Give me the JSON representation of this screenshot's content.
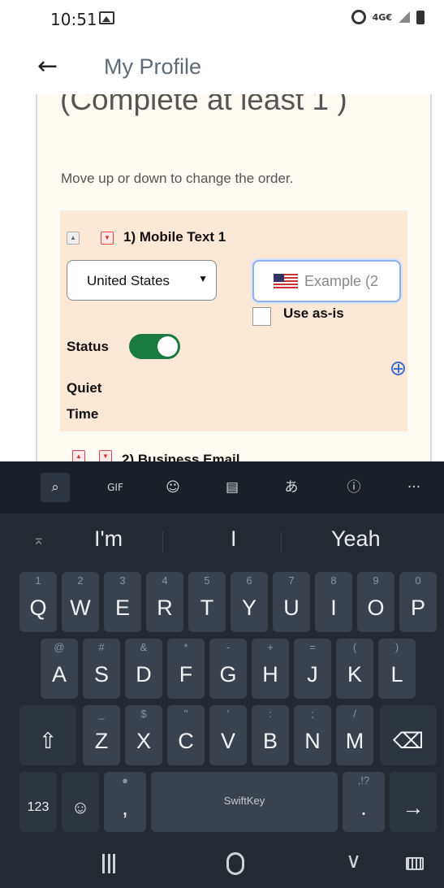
{
  "status_bar": {
    "time": "10:51",
    "network": "4G€"
  },
  "app_bar": {
    "back_icon": "←",
    "title": "My Profile"
  },
  "content": {
    "heading": "(Complete at least 1 )",
    "hint": "Move up or down to change the order.",
    "entry1": {
      "title": "1) Mobile Text 1",
      "country": "United States",
      "phone_placeholder": "Example (2",
      "use_as_is": "Use as-is",
      "status_label": "Status",
      "status_on": true,
      "quiet_time_label": "Quiet Time"
    },
    "entry2": {
      "title": "2) Business Email"
    }
  },
  "keyboard": {
    "toolbar": {
      "search": "search-icon",
      "gif": "GIF",
      "sticker": "sticker-icon",
      "clipboard": "clipboard-icon",
      "translate": "translate-icon",
      "info": "info-icon",
      "more": "···"
    },
    "suggestions": [
      "I'm",
      "I",
      "Yeah"
    ],
    "rows": [
      [
        {
          "k": "Q",
          "s": "1"
        },
        {
          "k": "W",
          "s": "2"
        },
        {
          "k": "E",
          "s": "3"
        },
        {
          "k": "R",
          "s": "4"
        },
        {
          "k": "T",
          "s": "5"
        },
        {
          "k": "Y",
          "s": "6"
        },
        {
          "k": "U",
          "s": "7"
        },
        {
          "k": "I",
          "s": "8"
        },
        {
          "k": "O",
          "s": "9"
        },
        {
          "k": "P",
          "s": "0"
        }
      ],
      [
        {
          "k": "A",
          "s": "@"
        },
        {
          "k": "S",
          "s": "#"
        },
        {
          "k": "D",
          "s": "&"
        },
        {
          "k": "F",
          "s": "*"
        },
        {
          "k": "G",
          "s": "-"
        },
        {
          "k": "H",
          "s": "+"
        },
        {
          "k": "J",
          "s": "="
        },
        {
          "k": "K",
          "s": "("
        },
        {
          "k": "L",
          "s": ")"
        }
      ],
      [
        {
          "k": "Z",
          "s": "_"
        },
        {
          "k": "X",
          "s": "$"
        },
        {
          "k": "C",
          "s": "\""
        },
        {
          "k": "V",
          "s": "'"
        },
        {
          "k": "B",
          "s": ":"
        },
        {
          "k": "N",
          "s": ";"
        },
        {
          "k": "M",
          "s": "/"
        }
      ]
    ],
    "shift": "⇧",
    "backspace": "⌫",
    "numbers": "123",
    "emoji": "☺",
    "comma": ",",
    "mic": "🎙",
    "space_brand": "SwiftKey",
    "period": ".",
    "punct": ",!?",
    "enter": "→"
  },
  "nav": {
    "back": "∨"
  }
}
